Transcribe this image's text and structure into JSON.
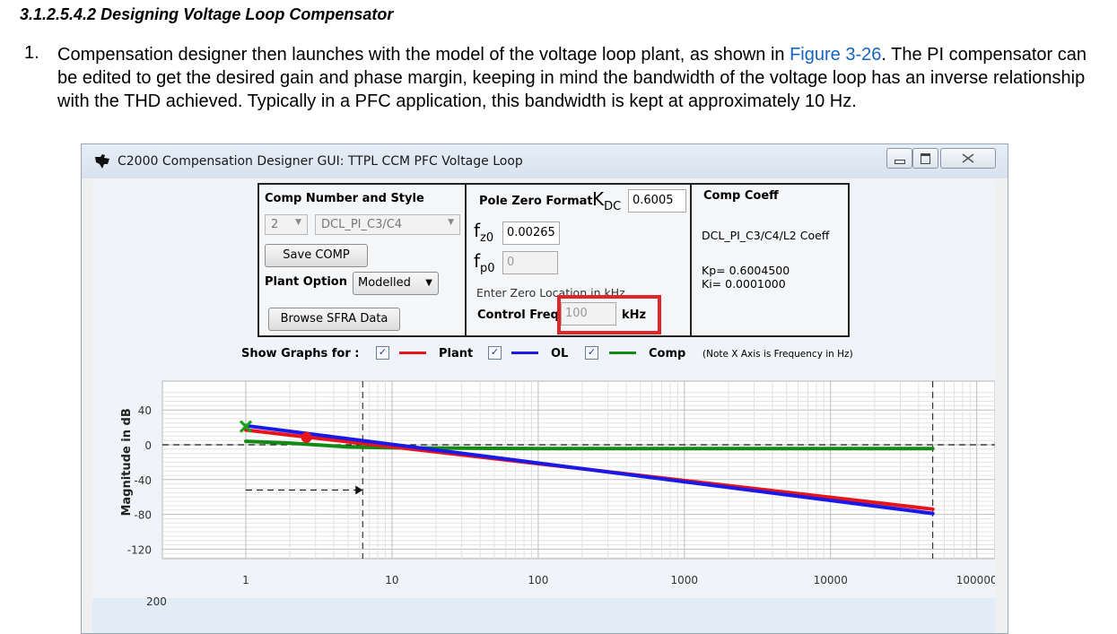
{
  "doc": {
    "heading": "3.1.2.5.4.2 Designing Voltage Loop Compensator",
    "step_number": "1.",
    "step_text_before": "Compensation designer then launches with the model of the voltage loop plant, as shown in ",
    "step_link": "Figure 3-26",
    "step_text_after": ". The PI compensator can be edited to get the desired gain and phase margin, keeping in mind the bandwidth of the voltage loop has an inverse relationship with the THD achieved. Typically in a PFC application, this bandwidth is kept at approximately 10 Hz."
  },
  "window": {
    "title": "C2000 Compensation Designer GUI: TTPL CCM PFC Voltage Loop",
    "icon": "ti-logo-icon"
  },
  "comp_panel": {
    "title": "Comp Number and Style",
    "comp_number": "2",
    "comp_style": "DCL_PI_C3/C4",
    "save_label": "Save COMP",
    "plant_option_label": "Plant Option",
    "plant_option_value": "Modelled",
    "browse_label": "Browse SFRA Data"
  },
  "pz_panel": {
    "title": "Pole Zero Format",
    "kdc_main": "K",
    "kdc_sub": "DC",
    "kdc_value": "0.6005",
    "fz_main": "f",
    "fz_sub": "z0",
    "fz_value": "0.00265",
    "fp_main": "f",
    "fp_sub": "p0",
    "fp_value": "0",
    "hint": "Enter Zero Location in kHz",
    "control_freq_label": "Control Freq",
    "control_freq_value": "100",
    "control_freq_unit": "kHz"
  },
  "coeff_panel": {
    "title": "Comp Coeff",
    "coeff_name": "DCL_PI_C3/C4/L2 Coeff",
    "kp": "Kp= 0.6004500",
    "ki": "Ki= 0.0001000"
  },
  "graphs": {
    "show_label": "Show Graphs for :",
    "plant_label": "Plant",
    "ol_label": "OL",
    "comp_label": "Comp",
    "note": "(Note X Axis is Frequency in Hz)",
    "colors": {
      "plant": "#e8141a",
      "ol": "#1a1ae8",
      "comp": "#138a13"
    }
  },
  "chart_data": {
    "type": "line",
    "xscale": "log",
    "xlim": [
      1,
      100000
    ],
    "ylim": [
      -140,
      60
    ],
    "ylabel": "Magnitude in dB",
    "x_ticks": [
      "1",
      "10",
      "100",
      "1000",
      "10000",
      "100000"
    ],
    "y_ticks": [
      "40",
      "0",
      "-40",
      "-80",
      "-120"
    ],
    "series": [
      {
        "name": "Plant",
        "color": "#e8141a",
        "x": [
          1,
          50000
        ],
        "y": [
          17,
          -74
        ]
      },
      {
        "name": "OL",
        "color": "#1a1ae8",
        "x": [
          1,
          50000
        ],
        "y": [
          22,
          -79
        ]
      },
      {
        "name": "Comp",
        "color": "#138a13",
        "x": [
          1,
          2,
          3,
          5,
          10,
          100,
          50000
        ],
        "y": [
          4,
          2,
          0,
          -2.5,
          -3.5,
          -4.4,
          -4.4
        ]
      }
    ],
    "crossover_hz": 6.3,
    "next_axis_tick": "200"
  }
}
